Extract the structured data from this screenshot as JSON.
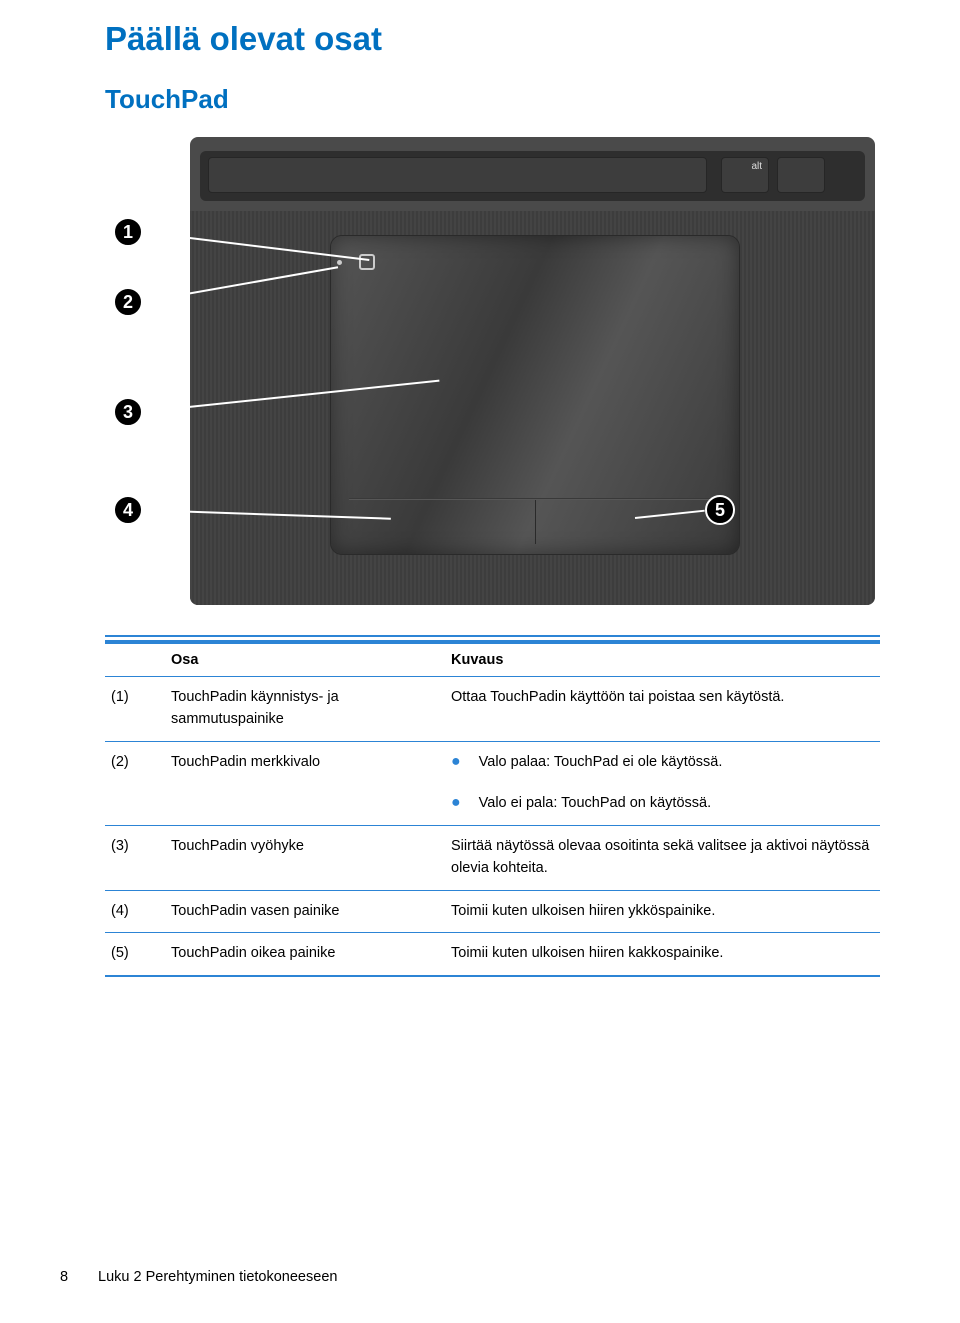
{
  "headings": {
    "h1": "Päällä olevat osat",
    "h2": "TouchPad"
  },
  "figure": {
    "callouts": [
      "1",
      "2",
      "3",
      "4",
      "5"
    ],
    "key_label": "alt"
  },
  "table": {
    "headers": {
      "col1": "Osa",
      "col2": "",
      "col3": "Kuvaus"
    },
    "rows": [
      {
        "num": "(1)",
        "name": "TouchPadin käynnistys- ja sammutuspainike",
        "desc": "Ottaa TouchPadin käyttöön tai poistaa sen käytöstä."
      },
      {
        "num": "(2)",
        "name": "TouchPadin merkkivalo",
        "bullets": [
          "Valo palaa: TouchPad ei ole käytössä.",
          "Valo ei pala: TouchPad on käytössä."
        ]
      },
      {
        "num": "(3)",
        "name": "TouchPadin vyöhyke",
        "desc": "Siirtää näytössä olevaa osoitinta sekä valitsee ja aktivoi näytössä olevia kohteita."
      },
      {
        "num": "(4)",
        "name": "TouchPadin vasen painike",
        "desc": "Toimii kuten ulkoisen hiiren ykköspainike."
      },
      {
        "num": "(5)",
        "name": "TouchPadin oikea painike",
        "desc": "Toimii kuten ulkoisen hiiren kakkospainike."
      }
    ]
  },
  "footer": {
    "page": "8",
    "chapter": "Luku 2   Perehtyminen tietokoneeseen"
  }
}
